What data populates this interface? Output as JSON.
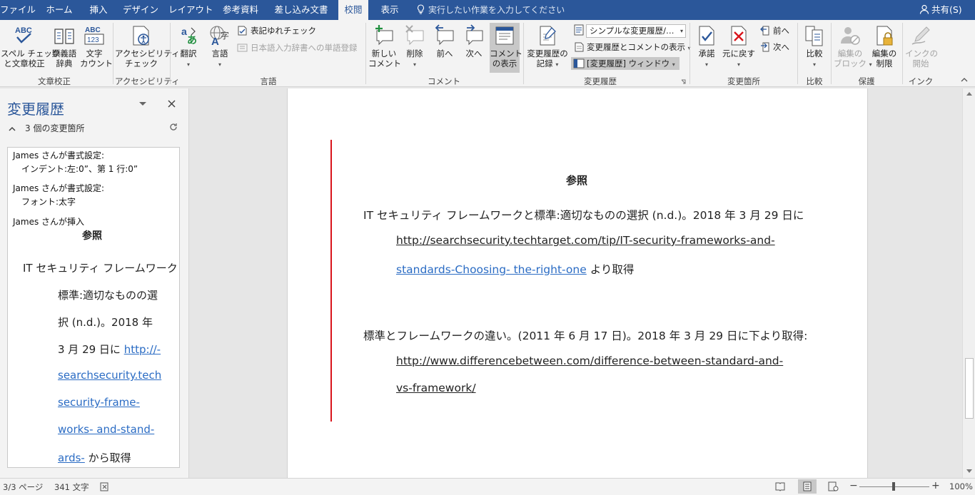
{
  "tabs": [
    {
      "label": "ファイル"
    },
    {
      "label": "ホーム"
    },
    {
      "label": "挿入"
    },
    {
      "label": "デザイン"
    },
    {
      "label": "レイアウト"
    },
    {
      "label": "参考資料"
    },
    {
      "label": "差し込み文書"
    },
    {
      "label": "校閲",
      "active": true
    },
    {
      "label": "表示"
    }
  ],
  "tellme": "実行したい作業を入力してください",
  "share": "共有(S)",
  "ribbon": {
    "proofing": {
      "spell_line1": "スペル チェック",
      "spell_line2": "と文章校正",
      "thesaurus_line1": "類義語",
      "thesaurus_line2": "辞典",
      "wordcount_line1": "文字",
      "wordcount_line2": "カウント",
      "label": "文章校正"
    },
    "accessibility": {
      "check_line1": "アクセシビリティ",
      "check_line2": "チェック",
      "label": "アクセシビリティ"
    },
    "language": {
      "translate": "翻訳",
      "language": "言語",
      "consistency": "表記ゆれチェック",
      "ime_dict": "日本語入力辞書への単語登録",
      "label": "言語"
    },
    "comments": {
      "new_line1": "新しい",
      "new_line2": "コメント",
      "delete": "削除",
      "prev": "前へ",
      "next": "次へ",
      "show_line1": "コメント",
      "show_line2": "の表示",
      "label": "コメント"
    },
    "tracking": {
      "track_line1": "変更履歴の",
      "track_line2": "記録",
      "markup_combo": "シンプルな変更履歴/…",
      "show_markup": "変更履歴とコメントの表示",
      "reviewing_pane": "[変更履歴] ウィンドウ",
      "label": "変更履歴"
    },
    "changes": {
      "accept": "承諾",
      "reject": "元に戻す",
      "prev": "前へ",
      "next": "次へ",
      "label": "変更箇所"
    },
    "compare": {
      "compare": "比較",
      "label": "比較"
    },
    "protect": {
      "block_line1": "編集の",
      "block_line2": "ブロック",
      "restrict_line1": "編集の",
      "restrict_line2": "制限",
      "label": "保護"
    },
    "ink": {
      "start_line1": "インクの",
      "start_line2": "開始",
      "label": "インク"
    }
  },
  "pane": {
    "title": "変更履歴",
    "count": "3 個の変更箇所",
    "revisions": {
      "r1_head": "James さんが書式設定:",
      "r1_detail": "インデント:左:0”、第 1 行:0”",
      "r2_head": "James さんが書式設定:",
      "r2_detail": "フォント:太字",
      "r3_head": "James さんが挿入",
      "heading": "参照",
      "p1": "IT セキュリティ フレームワークと",
      "p2": "標準:適切なものの選",
      "p3": "択 (n.d.)。2018 年",
      "p4_text": "3 月 29 日に",
      "p4_link": "http://-",
      "p5": "searchsecurity.tech",
      "p6": "security-frame-",
      "p7": "works- and-stand-",
      "p8_link": "ards-",
      "p8_text": "から取得"
    }
  },
  "document": {
    "heading": "参照",
    "ref1": {
      "line1": "IT セキュリティ フレームワークと標準:適切なものの選択 (n.d.)。2018 年 3 月 29 日に",
      "link_line1": "http://searchsecurity.techtarget.com/tip/IT-security-frameworks-and-",
      "link_line2": "standards-Choosing- the-right-one",
      "suffix": "より取得"
    },
    "ref2": {
      "line1": "標準とフレームワークの違い。(2011 年 6 月 17 日)。2018 年 3 月 29 日に下より取得:",
      "link_line1": "http://www.differencebetween.com/difference-between-standard-and-",
      "link_line2": "vs-framework/"
    }
  },
  "status": {
    "page": "3/3 ページ",
    "words": "341 文字",
    "zoom": "100%"
  },
  "colors": {
    "accent": "#2b579a",
    "link": "#2b6cc4",
    "change_bar": "#d9141b"
  }
}
